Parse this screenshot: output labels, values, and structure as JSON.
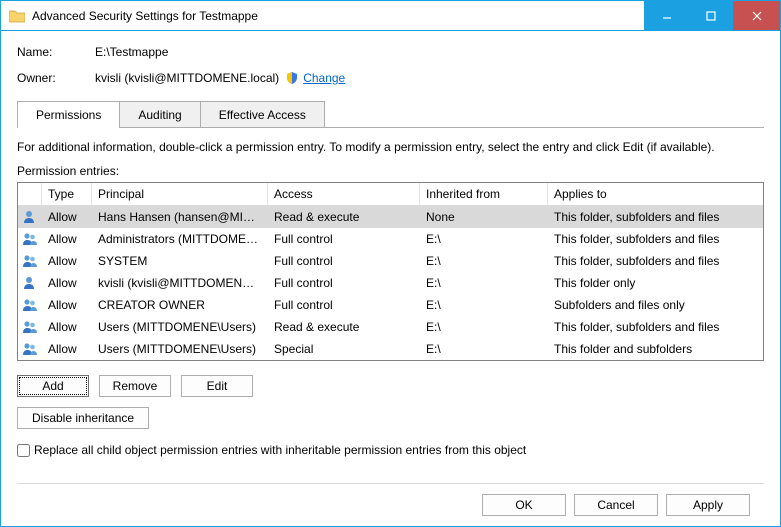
{
  "window": {
    "title": "Advanced Security Settings for Testmappe"
  },
  "header": {
    "name_label": "Name:",
    "name_value": "E:\\Testmappe",
    "owner_label": "Owner:",
    "owner_value": "kvisli (kvisli@MITTDOMENE.local)",
    "change_link": "Change"
  },
  "tabs": {
    "items": [
      {
        "label": "Permissions",
        "active": true
      },
      {
        "label": "Auditing",
        "active": false
      },
      {
        "label": "Effective Access",
        "active": false
      }
    ]
  },
  "info_text": "For additional information, double-click a permission entry. To modify a permission entry, select the entry and click Edit (if available).",
  "entries_label": "Permission entries:",
  "table": {
    "columns": {
      "type": "Type",
      "principal": "Principal",
      "access": "Access",
      "inherited": "Inherited from",
      "applies": "Applies to"
    },
    "rows": [
      {
        "icon": "user-single",
        "type": "Allow",
        "principal": "Hans Hansen (hansen@MITT...",
        "access": "Read & execute",
        "inherited": "None",
        "applies": "This folder, subfolders and files",
        "selected": true
      },
      {
        "icon": "user-group",
        "type": "Allow",
        "principal": "Administrators (MITTDOMEN...",
        "access": "Full control",
        "inherited": "E:\\",
        "applies": "This folder, subfolders and files",
        "selected": false
      },
      {
        "icon": "user-group",
        "type": "Allow",
        "principal": "SYSTEM",
        "access": "Full control",
        "inherited": "E:\\",
        "applies": "This folder, subfolders and files",
        "selected": false
      },
      {
        "icon": "user-single",
        "type": "Allow",
        "principal": "kvisli (kvisli@MITTDOMENE.l...",
        "access": "Full control",
        "inherited": "E:\\",
        "applies": "This folder only",
        "selected": false
      },
      {
        "icon": "user-group",
        "type": "Allow",
        "principal": "CREATOR OWNER",
        "access": "Full control",
        "inherited": "E:\\",
        "applies": "Subfolders and files only",
        "selected": false
      },
      {
        "icon": "user-group",
        "type": "Allow",
        "principal": "Users (MITTDOMENE\\Users)",
        "access": "Read & execute",
        "inherited": "E:\\",
        "applies": "This folder, subfolders and files",
        "selected": false
      },
      {
        "icon": "user-group",
        "type": "Allow",
        "principal": "Users (MITTDOMENE\\Users)",
        "access": "Special",
        "inherited": "E:\\",
        "applies": "This folder and subfolders",
        "selected": false
      }
    ]
  },
  "buttons": {
    "add": "Add",
    "remove": "Remove",
    "edit": "Edit",
    "disable_inheritance": "Disable inheritance"
  },
  "checkbox": {
    "label": "Replace all child object permission entries with inheritable permission entries from this object"
  },
  "footer": {
    "ok": "OK",
    "cancel": "Cancel",
    "apply": "Apply"
  }
}
